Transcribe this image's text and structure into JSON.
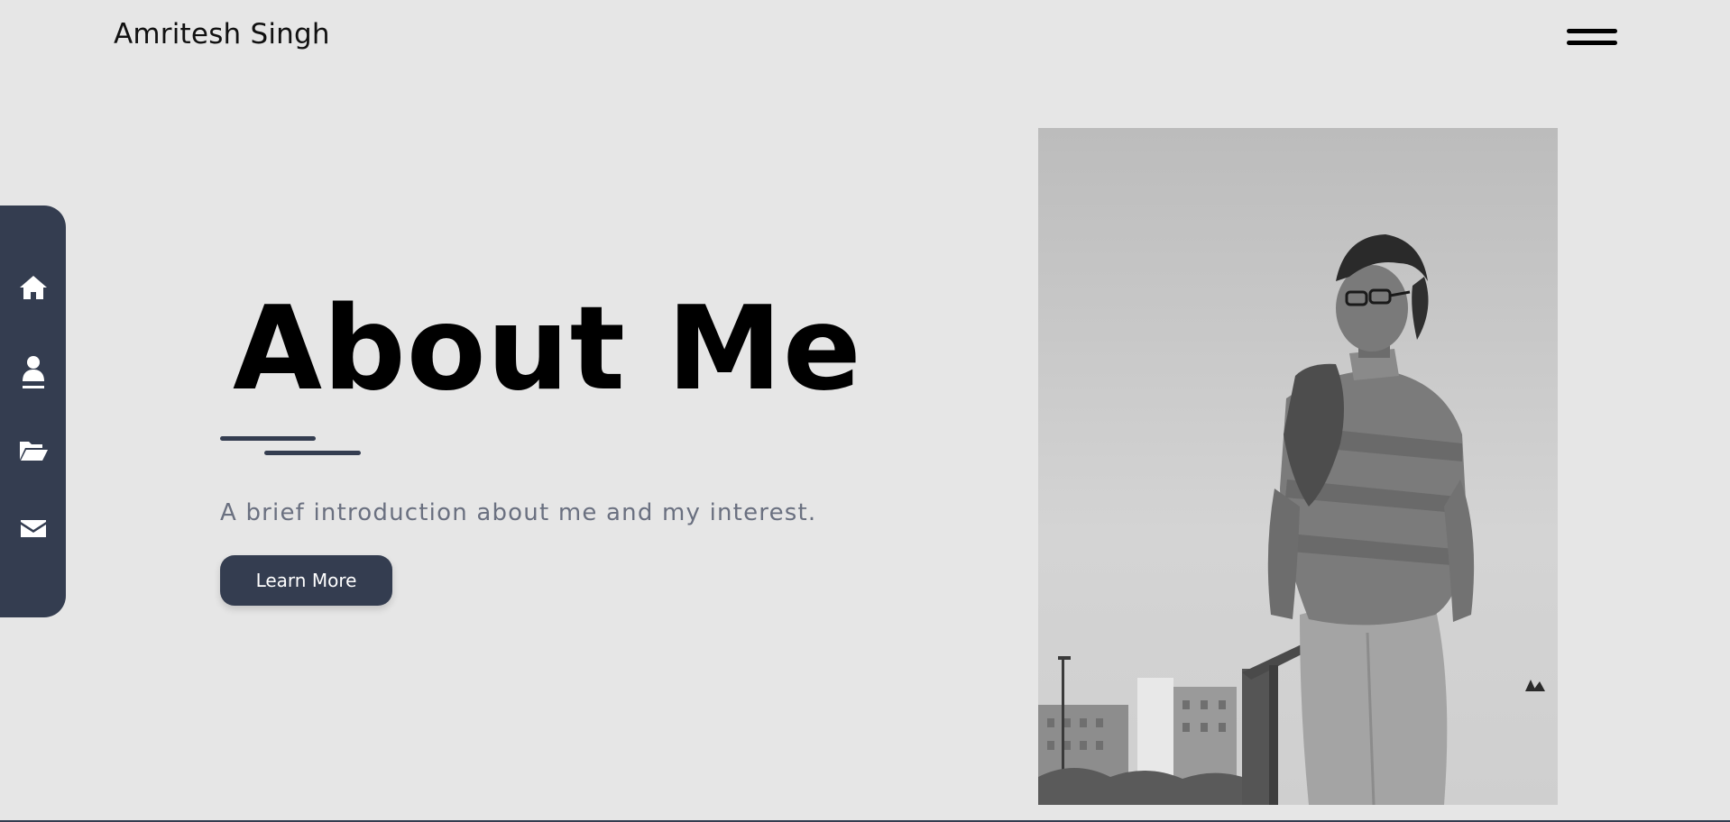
{
  "header": {
    "brand": "Amritesh Singh",
    "menu_icon": "hamburger-menu-icon"
  },
  "sidebar": {
    "items": [
      {
        "name": "home",
        "icon": "home-icon"
      },
      {
        "name": "about",
        "icon": "user-icon"
      },
      {
        "name": "projects",
        "icon": "folder-open-icon"
      },
      {
        "name": "contact",
        "icon": "envelope-icon"
      }
    ]
  },
  "hero": {
    "title": "About Me",
    "subtitle": "A brief introduction about me and my interest.",
    "cta_label": "Learn More"
  },
  "photo": {
    "description_icon": "portrait-photo"
  },
  "colors": {
    "background": "#e6e6e6",
    "accent": "#343d50",
    "subtitle": "#6a7080"
  }
}
